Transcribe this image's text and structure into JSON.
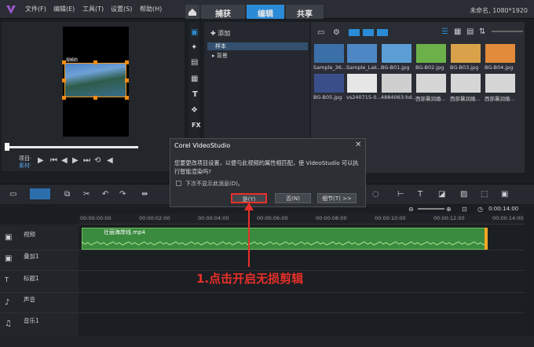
{
  "menu": {
    "file": "文件(F)",
    "edit": "编辑(E)",
    "tools": "工具(T)",
    "settings": "设置(S)",
    "help": "帮助(H)"
  },
  "tabs": {
    "capture": "捕获",
    "edit": "编辑",
    "share": "共享"
  },
  "project_info": "未命名, 1080*1920",
  "preview": {
    "clip_caption": "视频的",
    "project_label": "项目·",
    "clip_label": "素材·"
  },
  "library": {
    "add_label": "添加",
    "folders": [
      "样本",
      "背景"
    ],
    "thumbs": [
      {
        "label": "Sample_36...",
        "color": "#3b6fa8"
      },
      {
        "label": "Sample_Lak...",
        "color": "#4d87c4"
      },
      {
        "label": "BG-B01.jpg",
        "color": "#5b9ed6"
      },
      {
        "label": "BG-B02.jpg",
        "color": "#6cb04a"
      },
      {
        "label": "BG-B03.jpg",
        "color": "#d9a24a"
      },
      {
        "label": "BG-B04.jpg",
        "color": "#e08a3a"
      },
      {
        "label": "BG-B05.jpg",
        "color": "#3a4f8a"
      },
      {
        "label": "vs240715-0...",
        "color": "#e6e6e6"
      },
      {
        "label": "4884063-hd...",
        "color": "#cfcfcf"
      },
      {
        "label": "西部暑润婚...",
        "color": "#d6d6d6"
      },
      {
        "label": "西部暑润婚...",
        "color": "#d6d6d6"
      },
      {
        "label": "西部暑润婚...",
        "color": "#d6d6d6"
      }
    ]
  },
  "timeline": {
    "ticks": [
      "00:00:00:00",
      "00:00:02:00",
      "00:00:04:00",
      "00:00:06:00",
      "00:00:08:00",
      "00:00:10:00",
      "00:00:12:00",
      "00:00:14:00"
    ],
    "tracks": [
      "视频",
      "叠加1",
      "标题1",
      "声音",
      "音乐1"
    ],
    "clip_name": "壮丽海岸线.mp4",
    "zoom_time": "0:00:14:00"
  },
  "dialog": {
    "title": "Corel VideoStudio",
    "close": "✕",
    "message": "您要更改项目设置，以便与此视频的属性相匹配，使 VideoStudio 可以执行智能渲染吗?",
    "checkbox_label": "下次不显示此消息(D)。",
    "yes": "是(Y)",
    "no": "否(N)",
    "detail": "细节(T) >>"
  },
  "annotation": "1.点击开启无损剪辑",
  "colors": {
    "accent": "#2b8bd6",
    "highlight": "#e8302a",
    "clip": "#3a8a3f"
  }
}
